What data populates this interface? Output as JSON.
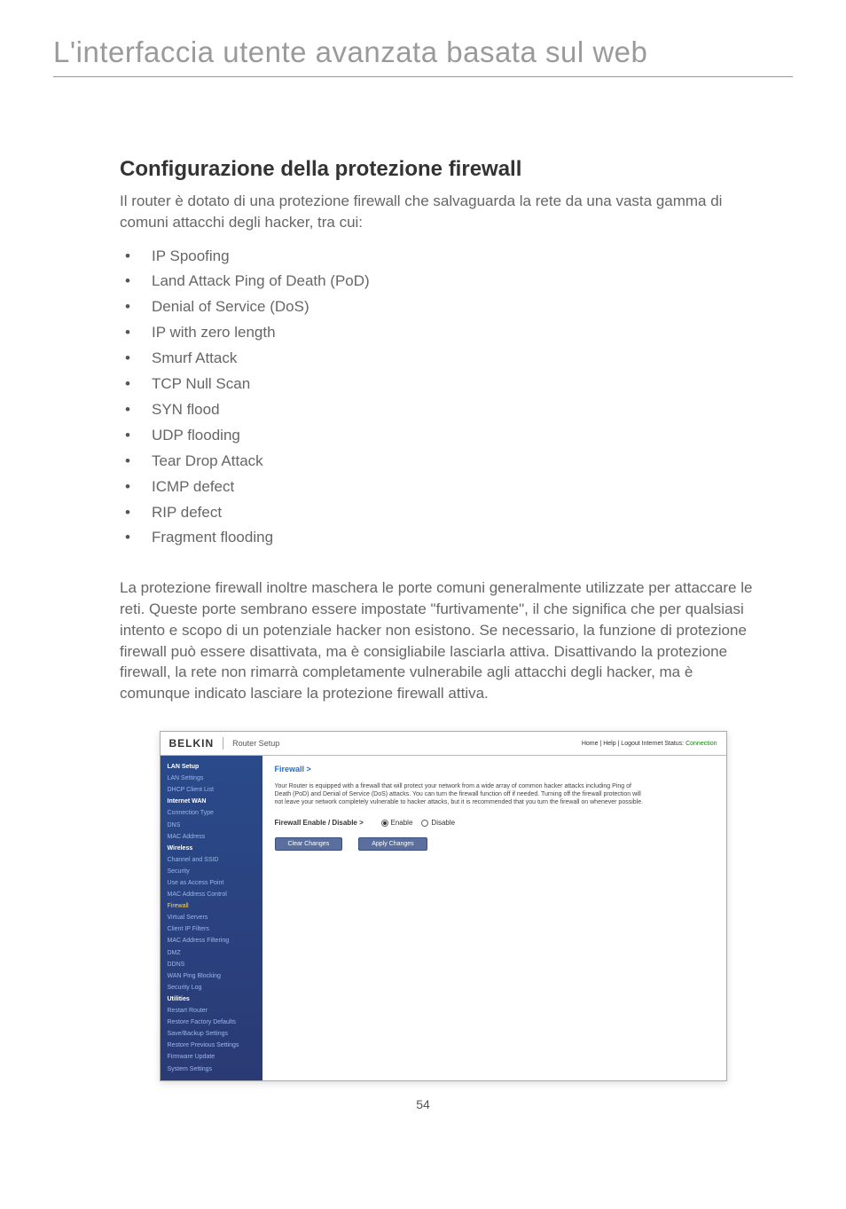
{
  "header": {
    "title": "L'interfaccia utente avanzata basata sul web"
  },
  "section": {
    "title": "Configurazione della protezione firewall",
    "intro": "Il router è dotato di una protezione firewall che salvaguarda la rete da una vasta gamma di comuni attacchi degli hacker, tra cui:",
    "bullets": [
      "IP Spoofing",
      "Land Attack Ping of Death (PoD)",
      "Denial of Service (DoS)",
      "IP with zero length",
      "Smurf Attack",
      "TCP Null Scan",
      "SYN flood",
      "UDP flooding",
      "Tear Drop Attack",
      "ICMP defect",
      "RIP defect",
      "Fragment flooding"
    ],
    "body": "La protezione firewall inoltre maschera le porte comuni generalmente utilizzate per attaccare le reti. Queste porte sembrano essere impostate \"furtivamente\", il che significa che per qualsiasi intento e scopo di un potenziale hacker non esistono. Se necessario, la funzione di protezione firewall può essere disattivata, ma è consigliabile lasciarla attiva. Disattivando la protezione firewall, la rete non rimarrà completamente vulnerabile agli attacchi degli hacker, ma è comunque indicato lasciare la protezione firewall attiva."
  },
  "screenshot": {
    "logo": "BELKIN",
    "logo_sub": "Router Setup",
    "header_links": "Home | Help | Logout   Internet Status: ",
    "header_status": "Connection",
    "sidebar": [
      {
        "label": "LAN Setup",
        "type": "cat"
      },
      {
        "label": "LAN Settings",
        "type": "item"
      },
      {
        "label": "DHCP Client List",
        "type": "item"
      },
      {
        "label": "Internet WAN",
        "type": "cat"
      },
      {
        "label": "Connection Type",
        "type": "item"
      },
      {
        "label": "DNS",
        "type": "item"
      },
      {
        "label": "MAC Address",
        "type": "item"
      },
      {
        "label": "Wireless",
        "type": "cat"
      },
      {
        "label": "Channel and SSID",
        "type": "item"
      },
      {
        "label": "Security",
        "type": "item"
      },
      {
        "label": "Use as Access Point",
        "type": "item"
      },
      {
        "label": "MAC Address Control",
        "type": "item"
      },
      {
        "label": "Firewall",
        "type": "active"
      },
      {
        "label": "Virtual Servers",
        "type": "item"
      },
      {
        "label": "Client IP Filters",
        "type": "item"
      },
      {
        "label": "MAC Address Filtering",
        "type": "item"
      },
      {
        "label": "DMZ",
        "type": "item"
      },
      {
        "label": "DDNS",
        "type": "item"
      },
      {
        "label": "WAN Ping Blocking",
        "type": "item"
      },
      {
        "label": "Security Log",
        "type": "item"
      },
      {
        "label": "Utilities",
        "type": "cat"
      },
      {
        "label": "Restart Router",
        "type": "item"
      },
      {
        "label": "Restore Factory Defaults",
        "type": "item"
      },
      {
        "label": "Save/Backup Settings",
        "type": "item"
      },
      {
        "label": "Restore Previous Settings",
        "type": "item"
      },
      {
        "label": "Firmware Update",
        "type": "item"
      },
      {
        "label": "System Settings",
        "type": "item"
      }
    ],
    "breadcrumb": "Firewall >",
    "desc": "Your Router is equipped with a firewall that will protect your network from a wide array of common hacker attacks including Ping of Death (PoD) and Denial of Service (DoS) attacks. You can turn the firewall function off if needed. Turning off the firewall protection will not leave your network completely vulnerable to hacker attacks, but it is recommended that you turn the firewall on whenever possible.",
    "row_label": "Firewall Enable / Disable >",
    "radio_enable": "Enable",
    "radio_disable": "Disable",
    "btn_clear": "Clear Changes",
    "btn_apply": "Apply Changes"
  },
  "page_number": "54"
}
